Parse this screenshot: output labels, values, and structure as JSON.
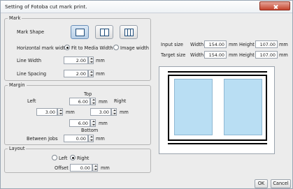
{
  "window": {
    "title": "Setting of Fotoba cut mark print."
  },
  "mark": {
    "group_label": "Mark",
    "shape_label": "Mark Shape",
    "horizontal_width_label": "Horizontal mark width",
    "option_fit": "Fit to Media Width",
    "option_image": "Image width",
    "line_width_label": "Line Width",
    "line_width_value": "2.00",
    "line_spacing_label": "Line Spacing",
    "line_spacing_value": "2.00",
    "unit": "mm"
  },
  "margin": {
    "group_label": "Margin",
    "top_label": "Top",
    "top_value": "6.00",
    "left_label": "Left",
    "left_value": "3.00",
    "right_label": "Right",
    "right_value": "3.00",
    "bottom_label": "Bottom",
    "bottom_value": "6.00",
    "between_label": "Between Jobs",
    "between_value": "0.00",
    "unit": "mm"
  },
  "layout": {
    "group_label": "Layout",
    "option_left": "Left",
    "option_right": "Right",
    "offset_label": "Offset",
    "offset_value": "0.00",
    "unit": "mm"
  },
  "input_size": {
    "label": "Input size",
    "width_label": "Width",
    "width_value": "154.00",
    "height_label": "Height",
    "height_value": "107.00",
    "unit": "mm"
  },
  "target_size": {
    "label": "Target size",
    "width_label": "Width",
    "width_value": "154.00",
    "height_label": "Height",
    "height_value": "107.00",
    "unit": "mm"
  },
  "buttons": {
    "ok": "OK",
    "cancel": "Cancel"
  },
  "colors": {
    "preview_media": "#b9def3",
    "accent": "#1f4d7a"
  }
}
